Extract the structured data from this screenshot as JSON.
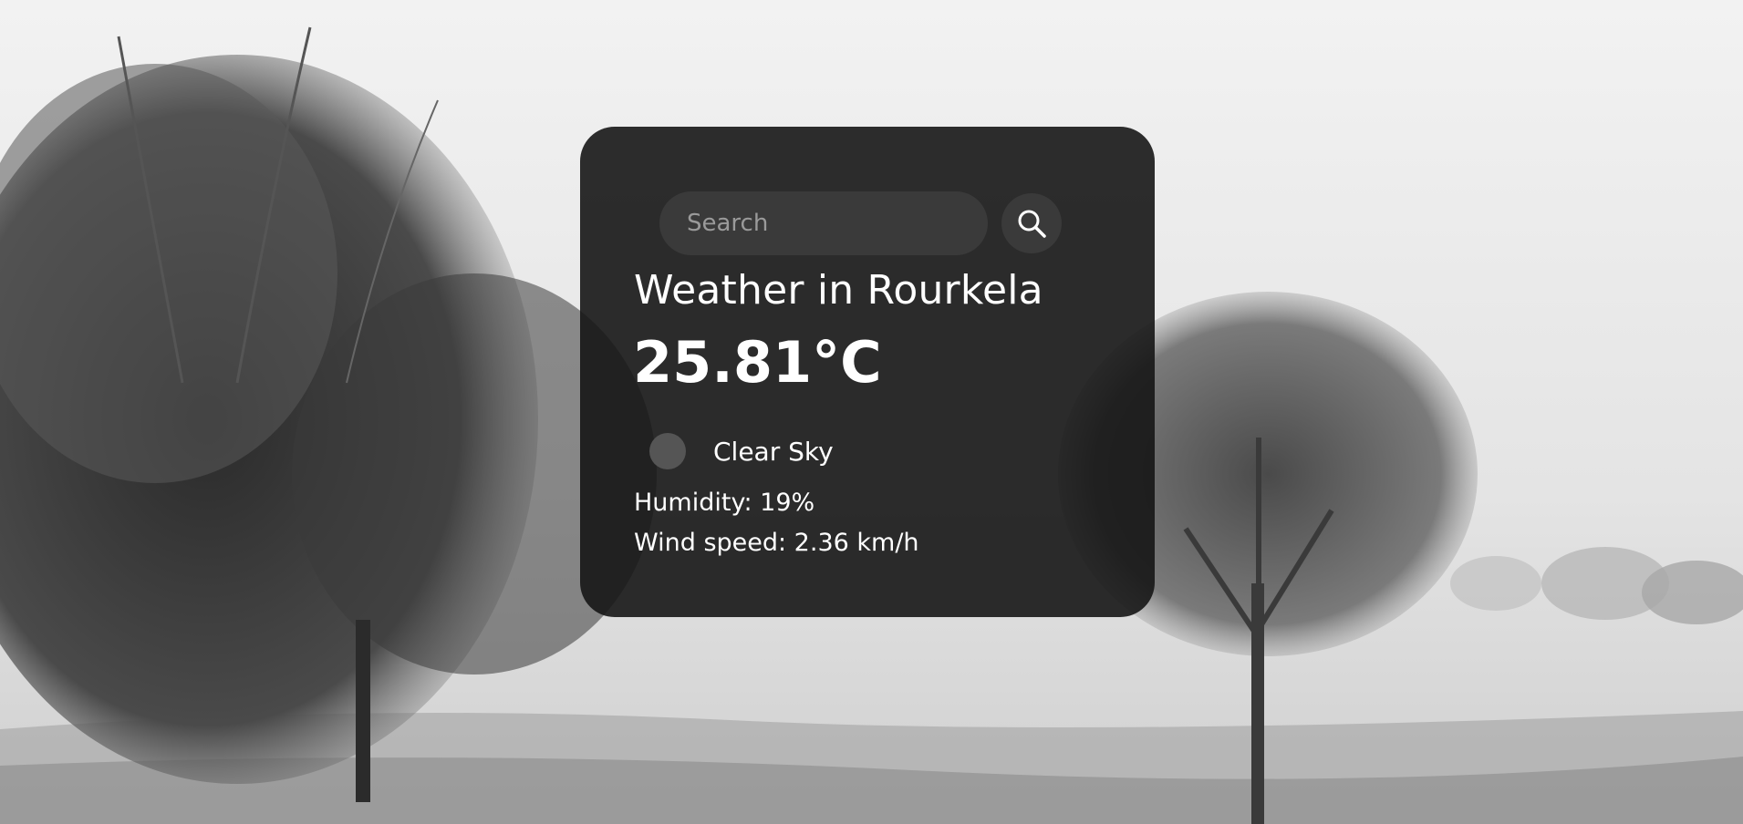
{
  "search": {
    "placeholder": "Search",
    "value": ""
  },
  "weather": {
    "title": "Weather in Rourkela",
    "temperature": "25.81°C",
    "condition": "Clear Sky",
    "humidity": "Humidity: 19%",
    "wind": "Wind speed: 2.36 km/h"
  },
  "icons": {
    "search_button": "search-icon",
    "condition": "weather-condition-icon"
  },
  "colors": {
    "card_background": "#161616",
    "input_background": "#3a3a3a",
    "text": "#ffffff"
  }
}
